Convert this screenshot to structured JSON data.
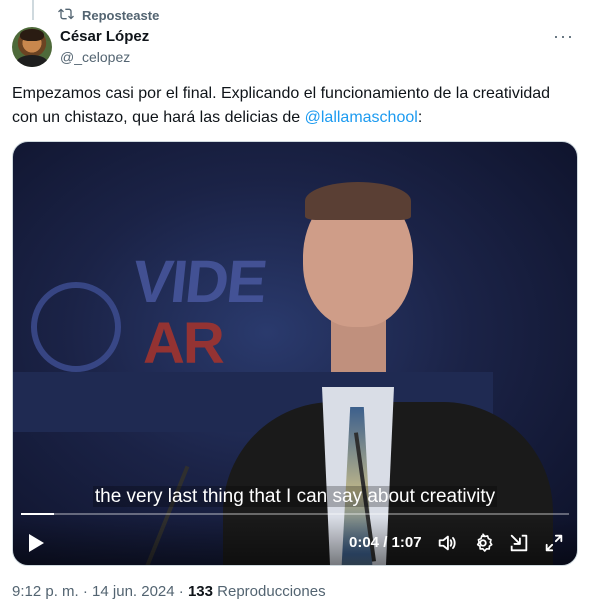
{
  "repost": {
    "label": "Reposteaste"
  },
  "author": {
    "name": "César López",
    "handle": "@_celopez"
  },
  "tweet": {
    "text_before": "Empezamos casi por el final. Explicando el funcionamiento de la creatividad con un chistazo, que hará las delicias de ",
    "mention": "@lallamaschool",
    "text_after": ":"
  },
  "video": {
    "caption": "the very last thing that I can say about creativity",
    "current_time": "0:04",
    "separator": " / ",
    "duration": "1:07",
    "progress": 0.06,
    "icons": [
      "play-icon",
      "volume-icon",
      "settings-icon",
      "minimize-icon",
      "fullscreen-icon"
    ]
  },
  "meta": {
    "time": "9:12 p. m.",
    "sep1": " · ",
    "date": "14 jun. 2024",
    "sep2": " · ",
    "views": "133",
    "views_label": " Reproducciones"
  },
  "colors": {
    "accent": "#1d9bf0",
    "secondary_text": "#536471"
  }
}
